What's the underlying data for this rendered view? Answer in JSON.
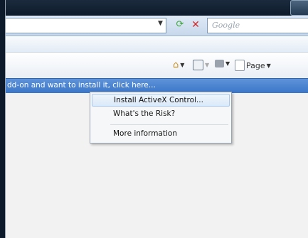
{
  "search": {
    "placeholder": "Google"
  },
  "commandbar": {
    "page_label": "Page"
  },
  "infobar": {
    "text": "dd-on and want to install it, click here..."
  },
  "context_menu": {
    "items": [
      {
        "label": "Install ActiveX Control..."
      },
      {
        "label": "What's the Risk?"
      },
      {
        "label": "More information"
      }
    ]
  },
  "colors": {
    "infobar": "#3a76c8",
    "stop": "#d12a2a",
    "refresh": "#3da33a"
  }
}
